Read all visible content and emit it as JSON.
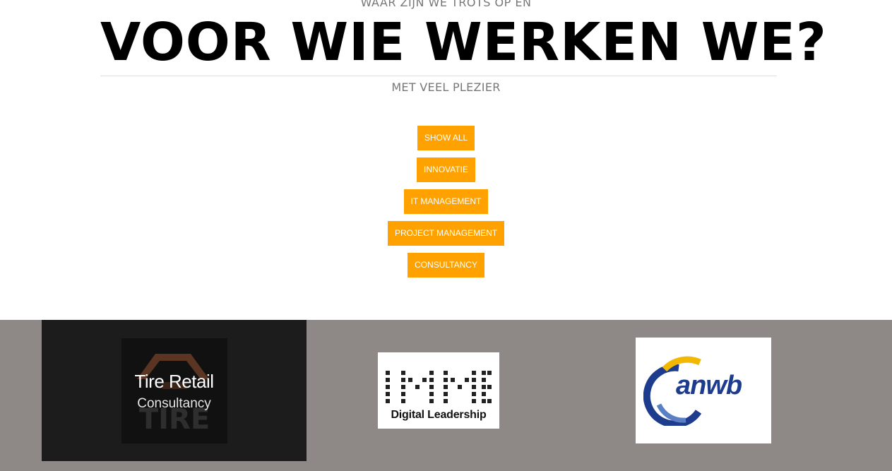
{
  "header": {
    "pre_title": "WAAR ZIJN WE TROTS OP EN",
    "title": "VOOR WIE WERKEN WE?",
    "subtitle": "MET VEEL PLEZIER"
  },
  "filters": [
    {
      "label": "SHOW ALL"
    },
    {
      "label": "INNOVATIE"
    },
    {
      "label": "IT MANAGEMENT"
    },
    {
      "label": "PROJECT MANAGEMENT"
    },
    {
      "label": "CONSULTANCY"
    }
  ],
  "portfolio": {
    "items": [
      {
        "title": "Tire Retail",
        "subtitle": "Consultancy",
        "watermark": "TIRE"
      },
      {
        "logo_text": "IMN",
        "tagline": "Digital Leadership"
      },
      {
        "logo_text": "anwb"
      }
    ]
  },
  "colors": {
    "accent": "#ffa200",
    "portfolio_bg": "#8e8886",
    "anwb_blue": "#1d3c8e",
    "anwb_yellow": "#f2b800"
  }
}
